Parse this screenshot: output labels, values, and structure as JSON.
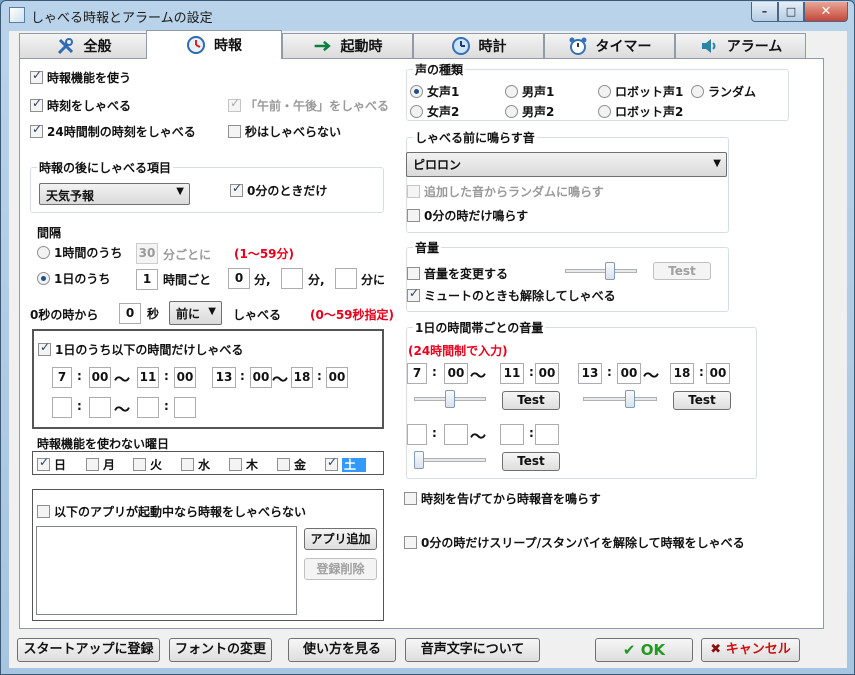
{
  "window": {
    "title": "しゃべる時報とアラームの設定"
  },
  "caption": {
    "minimize": "–",
    "maximize": "□",
    "close": "✕"
  },
  "tabs": [
    {
      "label": "全般",
      "icon": "tools-icon"
    },
    {
      "label": "時報",
      "icon": "clock-alarm-icon",
      "active": true
    },
    {
      "label": "起動時",
      "icon": "arrow-right-icon"
    },
    {
      "label": "時計",
      "icon": "clock-icon"
    },
    {
      "label": "タイマー",
      "icon": "alarm-clock-icon"
    },
    {
      "label": "アラーム",
      "icon": "speaker-icon"
    }
  ],
  "left": {
    "use_jihou": {
      "label": "時報機能を使う",
      "checked": true
    },
    "speak_time": {
      "label": "時刻をしゃべる",
      "checked": true
    },
    "ampm": {
      "label": "「午前・午後」をしゃべる",
      "checked": true,
      "disabled": true
    },
    "h24": {
      "label": "24時間制の時刻をしゃべる",
      "checked": true
    },
    "no_seconds": {
      "label": "秒はしゃべらない",
      "checked": false
    },
    "after_item": {
      "title": "時報の後にしゃべる項目",
      "combo_value": "天気予報",
      "zero_only": {
        "label": "0分のときだけ",
        "checked": true
      }
    },
    "interval": {
      "title": "間隔",
      "opt_hour": "1時間のうち",
      "hour_minutes": "30",
      "hour_suffix": "分ごとに",
      "hour_range": "(1〜59分)",
      "opt_day": "1日のうち",
      "day_hours": "1",
      "day_hours_suffix": "時間ごと",
      "day_min1": "0",
      "min_sep": "分,",
      "day_min2": "",
      "min_sep2": "分,",
      "day_min3": "",
      "min_end": "分に"
    },
    "offset": {
      "prefix": "0秒の時から",
      "seconds": "0",
      "sec_label": "秒",
      "when": "前に",
      "suffix": "しゃべる",
      "note": "(0〜59秒指定)"
    },
    "timeband": {
      "label": "1日のうち以下の時間だけしゃべる",
      "checked": true,
      "r1": {
        "h1": "7",
        "m1": "00",
        "h2": "11",
        "m2": "00"
      },
      "r2": {
        "h1": "13",
        "m1": "00",
        "h2": "18",
        "m2": "00"
      },
      "r3": {
        "h1": "",
        "m1": "",
        "h2": "",
        "m2": ""
      },
      "colon": ":",
      "tilde": "〜"
    },
    "weekdays": {
      "title": "時報機能を使わない曜日",
      "days": [
        {
          "label": "日",
          "checked": true
        },
        {
          "label": "月",
          "checked": false
        },
        {
          "label": "火",
          "checked": false
        },
        {
          "label": "水",
          "checked": false
        },
        {
          "label": "木",
          "checked": false
        },
        {
          "label": "金",
          "checked": false
        },
        {
          "label": "土",
          "checked": true
        }
      ]
    },
    "apps": {
      "label": "以下のアプリが起動中なら時報をしゃべらない",
      "checked": false,
      "add": "アプリ追加",
      "remove": "登録削除"
    }
  },
  "right": {
    "voice": {
      "title": "声の種類",
      "options": [
        "女声1",
        "男声1",
        "ロボット声1",
        "ランダム",
        "女声2",
        "男声2",
        "ロボット声2"
      ],
      "selected": "女声1"
    },
    "pre_sound": {
      "title": "しゃべる前に鳴らす音",
      "combo_value": "ピロロン",
      "random": {
        "label": "追加した音からランダムに鳴らす",
        "checked": false,
        "disabled": true
      },
      "zero_only": {
        "label": "0分の時だけ鳴らす",
        "checked": false
      }
    },
    "volume": {
      "title": "音量",
      "change": {
        "label": "音量を変更する",
        "checked": false
      },
      "test": "Test",
      "mute": {
        "label": "ミュートのときも解除してしゃべる",
        "checked": true
      },
      "level": 0.65
    },
    "band_volume": {
      "title": "1日の時間帯ごとの音量",
      "note": "(24時間制で入力)",
      "b1": {
        "h1": "7",
        "m1": "00",
        "h2": "11",
        "m2": "00",
        "level": 0.5,
        "test": "Test"
      },
      "b2": {
        "h1": "13",
        "m1": "00",
        "h2": "18",
        "m2": "00",
        "level": 0.65,
        "test": "Test"
      },
      "b3": {
        "h1": "",
        "m1": "",
        "h2": "",
        "m2": "",
        "level": 0.0,
        "test": "Test"
      }
    },
    "chime_after": {
      "label": "時刻を告げてから時報音を鳴らす",
      "checked": false
    },
    "wake": {
      "label": "0分の時だけスリープ/スタンバイを解除して時報をしゃべる",
      "checked": false
    }
  },
  "footer": {
    "startup": "スタートアップに登録",
    "font": "フォントの変更",
    "howto": "使い方を見る",
    "about": "音声文字について",
    "ok": "OK",
    "ok_icon": "✔",
    "cancel": "キャンセル",
    "cancel_icon": "✖"
  },
  "colors": {
    "accent_red": "#e8001c",
    "ok_green": "#1f9a1f",
    "cancel_red": "#d01010"
  }
}
